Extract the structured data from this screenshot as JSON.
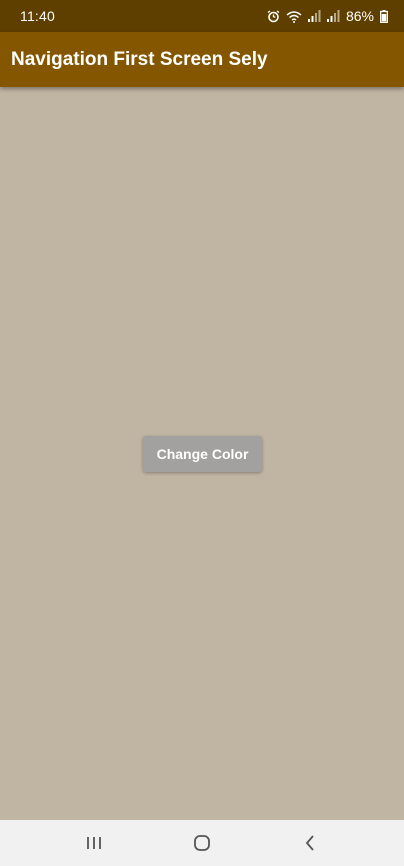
{
  "status_bar": {
    "time": "11:40",
    "battery": "86%",
    "icons": [
      "alarm-icon",
      "wifi-icon",
      "signal-icon",
      "signal-icon",
      "battery-icon"
    ]
  },
  "app_bar": {
    "title": "Navigation First Screen Sely"
  },
  "main": {
    "button_label": "Change Color"
  },
  "nav_bar": {
    "icons": [
      "recent-apps-icon",
      "home-icon",
      "back-icon"
    ]
  },
  "colors": {
    "status_bar": "#5f3f00",
    "app_bar": "#845600",
    "background": "#c0b4a2",
    "button": "#a3a19f"
  }
}
